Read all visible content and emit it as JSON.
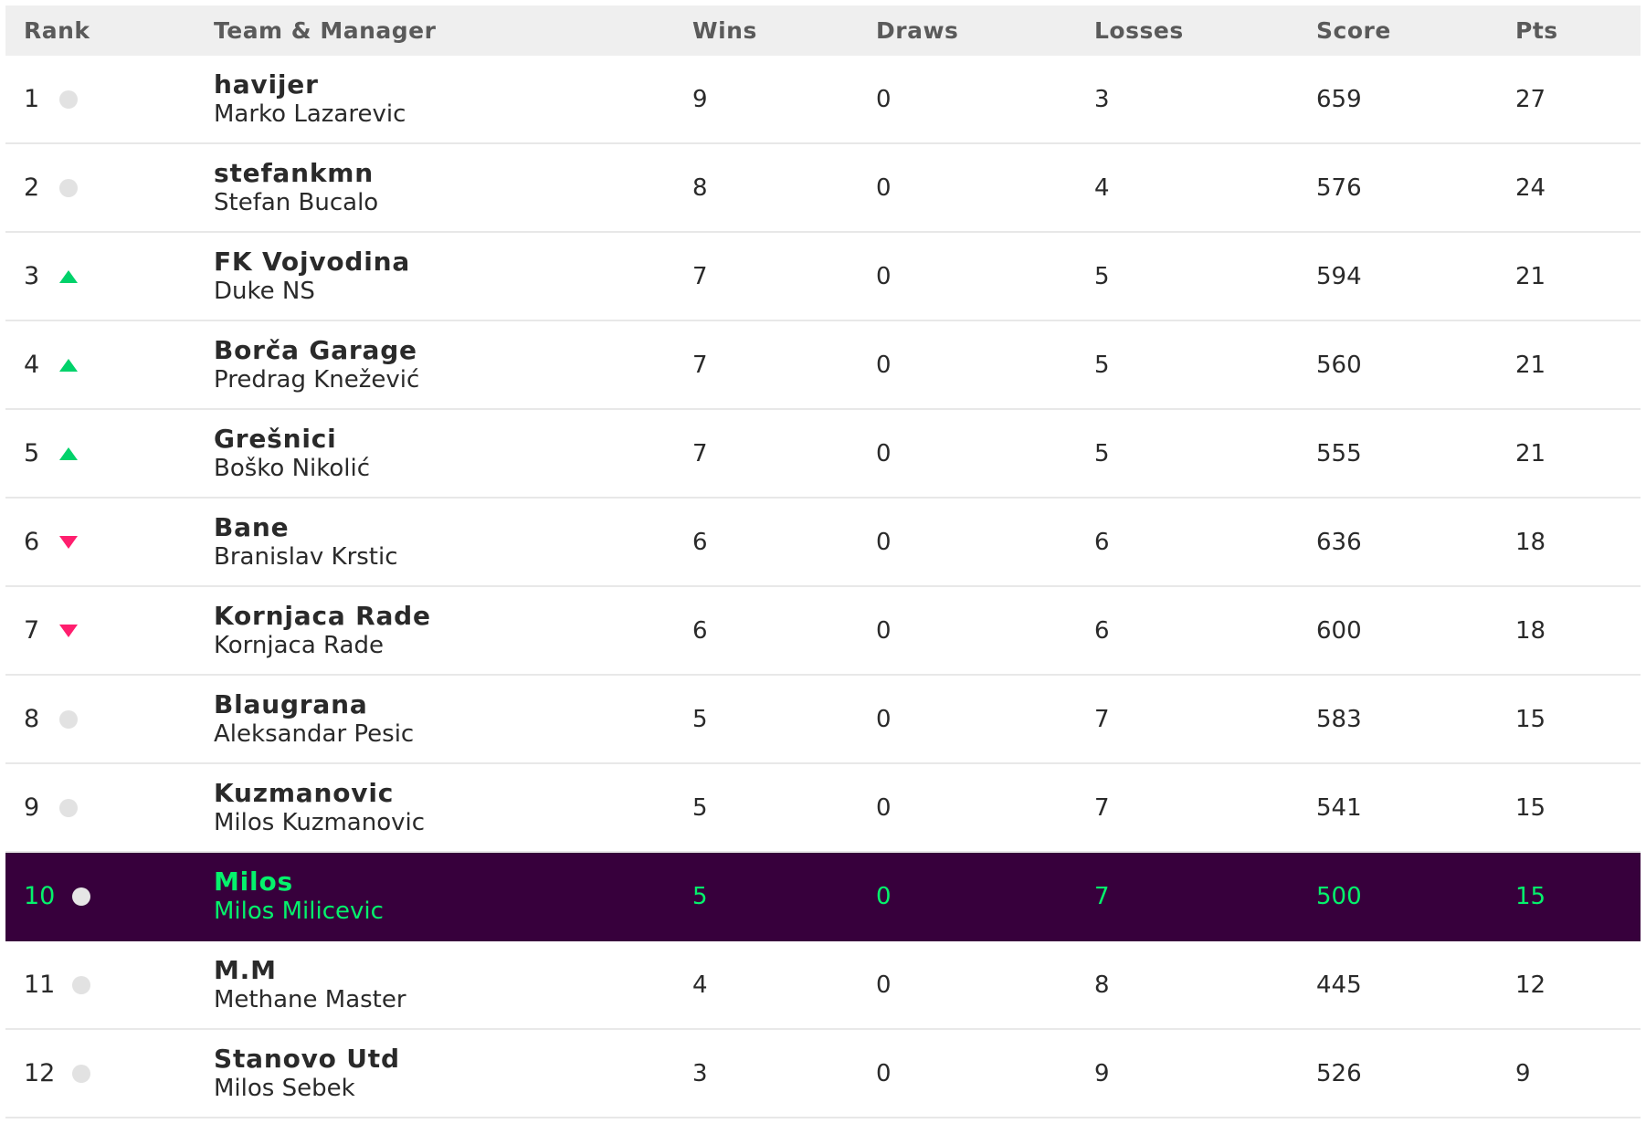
{
  "columns": {
    "rank": "Rank",
    "team": "Team & Manager",
    "wins": "Wins",
    "draws": "Draws",
    "losses": "Losses",
    "score": "Score",
    "pts": "Pts"
  },
  "colors": {
    "highlight_bg": "#37003c",
    "highlight_text": "#05f26c",
    "up": "#00d26a",
    "down": "#ff1e6e",
    "same": "#e2e2e2"
  },
  "rows": [
    {
      "rank": "1",
      "movement": "same",
      "team": "havijer",
      "manager": "Marko Lazarevic",
      "wins": "9",
      "draws": "0",
      "losses": "3",
      "score": "659",
      "pts": "27"
    },
    {
      "rank": "2",
      "movement": "same",
      "team": "stefankmn",
      "manager": "Stefan Bucalo",
      "wins": "8",
      "draws": "0",
      "losses": "4",
      "score": "576",
      "pts": "24"
    },
    {
      "rank": "3",
      "movement": "up",
      "team": "FK Vojvodina",
      "manager": "Duke NS",
      "wins": "7",
      "draws": "0",
      "losses": "5",
      "score": "594",
      "pts": "21"
    },
    {
      "rank": "4",
      "movement": "up",
      "team": "Borča Garage",
      "manager": "Predrag Knežević",
      "wins": "7",
      "draws": "0",
      "losses": "5",
      "score": "560",
      "pts": "21"
    },
    {
      "rank": "5",
      "movement": "up",
      "team": "Grešnici",
      "manager": "Boško Nikolić",
      "wins": "7",
      "draws": "0",
      "losses": "5",
      "score": "555",
      "pts": "21"
    },
    {
      "rank": "6",
      "movement": "down",
      "team": "Bane",
      "manager": "Branislav Krstic",
      "wins": "6",
      "draws": "0",
      "losses": "6",
      "score": "636",
      "pts": "18"
    },
    {
      "rank": "7",
      "movement": "down",
      "team": "Kornjaca Rade",
      "manager": "Kornjaca Rade",
      "wins": "6",
      "draws": "0",
      "losses": "6",
      "score": "600",
      "pts": "18"
    },
    {
      "rank": "8",
      "movement": "same",
      "team": "Blaugrana",
      "manager": "Aleksandar Pesic",
      "wins": "5",
      "draws": "0",
      "losses": "7",
      "score": "583",
      "pts": "15"
    },
    {
      "rank": "9",
      "movement": "same",
      "team": "Kuzmanovic",
      "manager": "Milos Kuzmanovic",
      "wins": "5",
      "draws": "0",
      "losses": "7",
      "score": "541",
      "pts": "15"
    },
    {
      "rank": "10",
      "movement": "same",
      "team": "Milos",
      "manager": "Milos Milicevic",
      "wins": "5",
      "draws": "0",
      "losses": "7",
      "score": "500",
      "pts": "15",
      "highlight": true
    },
    {
      "rank": "11",
      "movement": "same",
      "team": "M.M",
      "manager": "Methane Master",
      "wins": "4",
      "draws": "0",
      "losses": "8",
      "score": "445",
      "pts": "12"
    },
    {
      "rank": "12",
      "movement": "same",
      "team": "Stanovo Utd",
      "manager": "Milos Sebek",
      "wins": "3",
      "draws": "0",
      "losses": "9",
      "score": "526",
      "pts": "9"
    }
  ]
}
